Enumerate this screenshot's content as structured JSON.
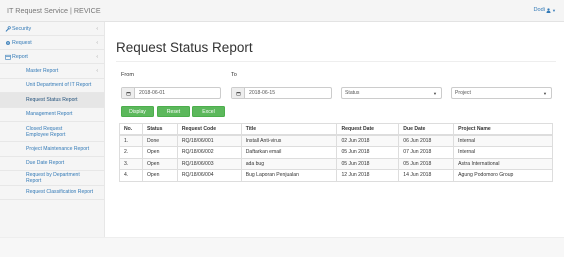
{
  "header": {
    "app_title": "IT Request Service | REVICE",
    "user_name": "Dodi"
  },
  "sidebar": {
    "items": [
      {
        "label": "Security",
        "icon": "wrench-icon"
      },
      {
        "label": "Request",
        "icon": "gear-icon"
      },
      {
        "label": "Report",
        "icon": "calendar-icon"
      }
    ],
    "report_items": [
      {
        "label": "Master Report"
      },
      {
        "label": "Unit Department of IT Report"
      },
      {
        "label": "Request Status Report"
      },
      {
        "label": "Management Report"
      },
      {
        "label": "Closed Request Employee Report"
      },
      {
        "label": "Project Maintenance Report"
      },
      {
        "label": "Due Date Report"
      },
      {
        "label": "Request by Department Report"
      },
      {
        "label": "Request Classification Report"
      }
    ]
  },
  "main": {
    "title": "Request Status Report",
    "filters": {
      "from_label": "From",
      "to_label": "To",
      "from_value": "2018-06-01",
      "to_value": "2018-06-15",
      "status_value": "Status",
      "project_value": "Project"
    },
    "buttons": {
      "display": "Display",
      "reset": "Reset",
      "excel": "Excel"
    },
    "table": {
      "columns": [
        "No.",
        "Status",
        "Request Code",
        "Title",
        "Request Date",
        "Due Date",
        "Project Name"
      ],
      "rows": [
        [
          "1.",
          "Done",
          "RQ/18/06/001",
          "Install Anti-virus",
          "02 Jun 2018",
          "06 Jun 2018",
          "Internal"
        ],
        [
          "2.",
          "Open",
          "RQ/18/06/002",
          "Daftarkan email",
          "05 Jun 2018",
          "07 Jun 2018",
          "Internal"
        ],
        [
          "3.",
          "Open",
          "RQ/18/06/003",
          "ada bug",
          "05 Jun 2018",
          "05 Jun 2018",
          "Astra International"
        ],
        [
          "4.",
          "Open",
          "RQ/18/06/004",
          "Bug Laporan Penjualan",
          "12 Jun 2018",
          "14 Jun 2018",
          "Agung Podomoro Group"
        ]
      ]
    }
  },
  "colors": {
    "link": "#337ab7",
    "button_green": "#5cb85c",
    "sidebar_bg": "#f5f5f5",
    "active_item_bg": "#e6e6e6"
  }
}
